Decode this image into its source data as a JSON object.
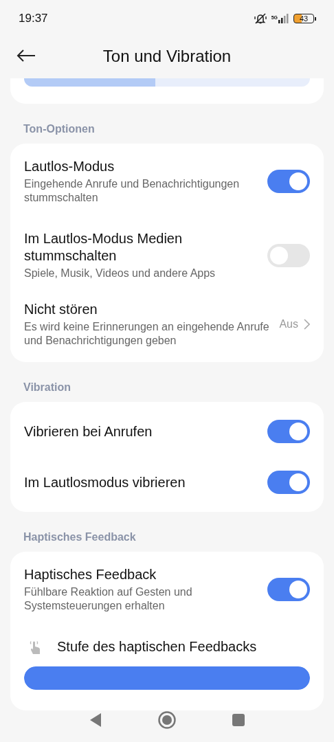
{
  "status_bar": {
    "time": "19:37",
    "network": "5G",
    "battery": "43"
  },
  "header": {
    "title": "Ton und Vibration"
  },
  "top_slider": {
    "level": 0.46
  },
  "sections": [
    {
      "title": "Ton-Optionen",
      "items": [
        {
          "kind": "toggle",
          "title": "Lautlos-Modus",
          "subtitle": "Eingehende Anrufe und Benachrichtigungen stummschalten",
          "on": true
        },
        {
          "kind": "toggle",
          "title": "Im Lautlos-Modus Medien stummschalten",
          "subtitle": "Spiele, Musik, Videos und andere Apps",
          "on": false
        },
        {
          "kind": "value",
          "title": "Nicht stören",
          "subtitle": "Es wird keine Erinnerungen an eingehende Anrufe und Benachrichtigungen geben",
          "value": "Aus"
        }
      ]
    },
    {
      "title": "Vibration",
      "items": [
        {
          "kind": "toggle",
          "title": "Vibrieren bei Anrufen",
          "on": true
        },
        {
          "kind": "toggle",
          "title": "Im Lautlosmodus vibrieren",
          "on": true
        }
      ]
    },
    {
      "title": "Haptisches Feedback",
      "items": [
        {
          "kind": "toggle",
          "title": "Haptisches Feedback",
          "subtitle": "Fühlbare Reaktion auf Gesten und Systemsteuerungen erhalten",
          "on": true
        },
        {
          "kind": "slider",
          "title": "Stufe des haptischen Feedbacks",
          "level": 1
        }
      ]
    }
  ]
}
